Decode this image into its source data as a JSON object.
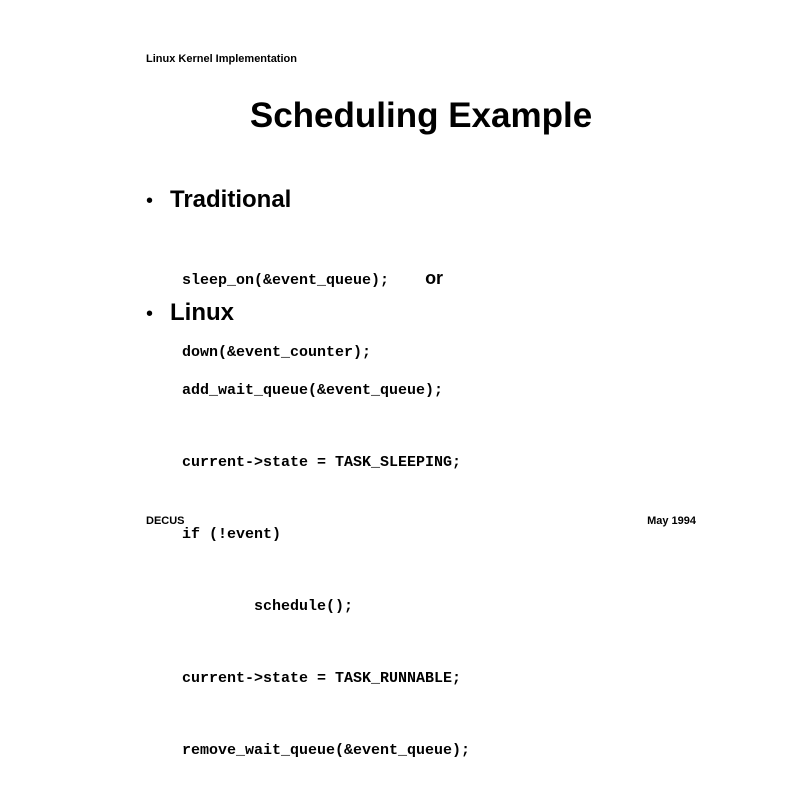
{
  "header": {
    "text": "Linux Kernel Implementation"
  },
  "title": "Scheduling Example",
  "sections": [
    {
      "heading": "Traditional",
      "code_lines": [
        "sleep_on(&event_queue);",
        "down(&event_counter);"
      ],
      "inline_note": "or"
    },
    {
      "heading": "Linux",
      "code_lines": [
        "add_wait_queue(&event_queue);",
        "current->state = TASK_SLEEPING;",
        "if (!event)",
        "        schedule();",
        "current->state = TASK_RUNNABLE;",
        "remove_wait_queue(&event_queue);"
      ]
    }
  ],
  "bullet_symbol": "•",
  "footer": {
    "left": "DECUS",
    "right": "May 1994"
  }
}
